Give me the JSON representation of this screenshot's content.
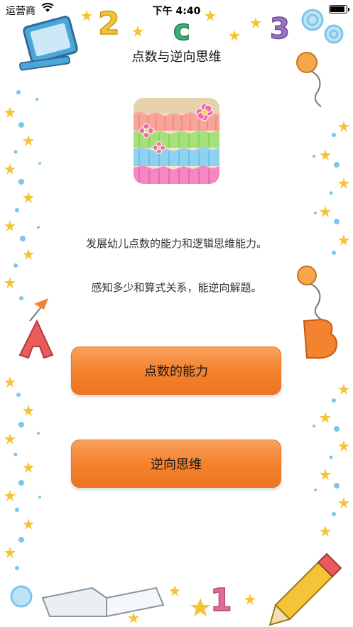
{
  "status_bar": {
    "carrier": "运营商",
    "time": "下午 4:40"
  },
  "page": {
    "title": "点数与逆向思维"
  },
  "description": {
    "line1": "发展幼儿点数的能力和逻辑思维能力。",
    "line2": "感知多少和算式关系，能逆向解题。"
  },
  "actions": {
    "counting_label": "点数的能力",
    "reverse_label": "逆向思维"
  },
  "colors": {
    "button": "#f4832f",
    "star": "#f5c436",
    "dot": "#7cc6ec"
  },
  "icons": [
    "wifi-icon",
    "battery-icon",
    "app-logo-icon"
  ]
}
